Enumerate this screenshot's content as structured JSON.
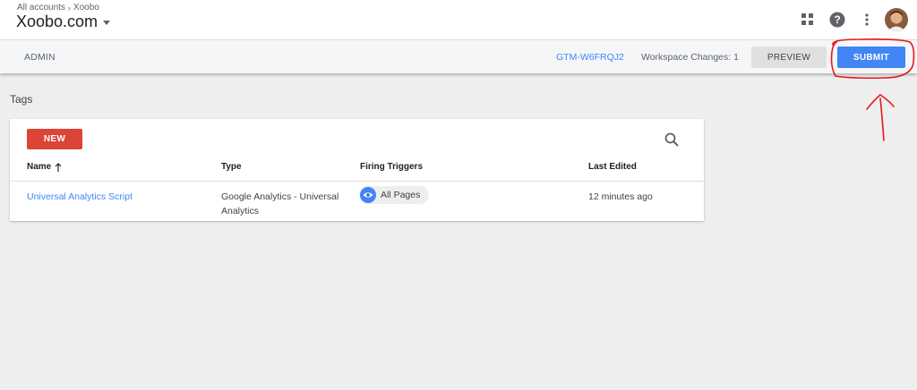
{
  "header": {
    "breadcrumb": {
      "account": "All accounts",
      "container": "Xoobo"
    },
    "container_name": "Xoobo.com",
    "icons": [
      "apps-grid-icon",
      "help-icon",
      "more-vert-icon",
      "avatar"
    ]
  },
  "subbar": {
    "admin_label": "ADMIN",
    "container_id": "GTM-W6FRQJ2",
    "workspace_changes": "Workspace Changes: 1",
    "preview_label": "PREVIEW",
    "submit_label": "SUBMIT"
  },
  "page": {
    "section_title": "Tags"
  },
  "tags_table": {
    "new_label": "NEW",
    "columns": {
      "name": "Name",
      "type": "Type",
      "triggers": "Firing Triggers",
      "last_edited": "Last Edited"
    },
    "rows": [
      {
        "name": "Universal Analytics Script",
        "type": "Google Analytics - Universal Analytics",
        "trigger": "All Pages",
        "last_edited": "12 minutes ago"
      }
    ]
  },
  "colors": {
    "accent": "#4285f4",
    "new_button": "#db4437",
    "annotation": "#e8161b"
  }
}
